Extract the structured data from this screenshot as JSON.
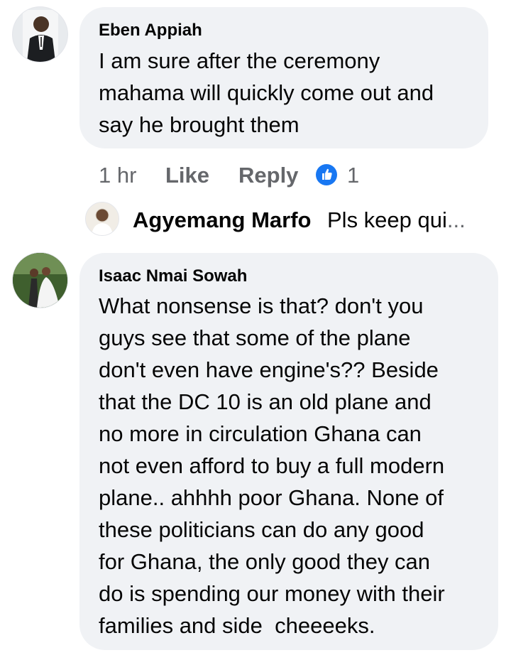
{
  "comments": [
    {
      "author": "Eben Appiah",
      "text_lines": [
        "I am sure after the ceremony",
        "mahama will quickly come out and",
        "say he brought them"
      ],
      "time": "1 hr",
      "like_label": "Like",
      "reply_label": "Reply",
      "reaction_count": "1",
      "reply_preview": {
        "author": "Agyemang Marfo",
        "text": "Pls keep qui",
        "ellipsis": "..."
      }
    },
    {
      "author": "Isaac Nmai Sowah",
      "text_lines": [
        "What nonsense is that? don't you",
        "guys see that some of the plane",
        "don't even have engine's?? Beside",
        "that the DC 10 is an old plane and",
        "no more in circulation Ghana can",
        "not even afford to buy a full modern",
        "plane.. ahhhh poor Ghana. None of",
        "these politicians can do any good",
        "for Ghana, the only good they can",
        "do is spending our money with their",
        "families and side  cheeeeks."
      ]
    }
  ],
  "colors": {
    "bubble": "#f0f2f5",
    "meta_text": "#65676b",
    "like_blue": "#1877f2"
  }
}
